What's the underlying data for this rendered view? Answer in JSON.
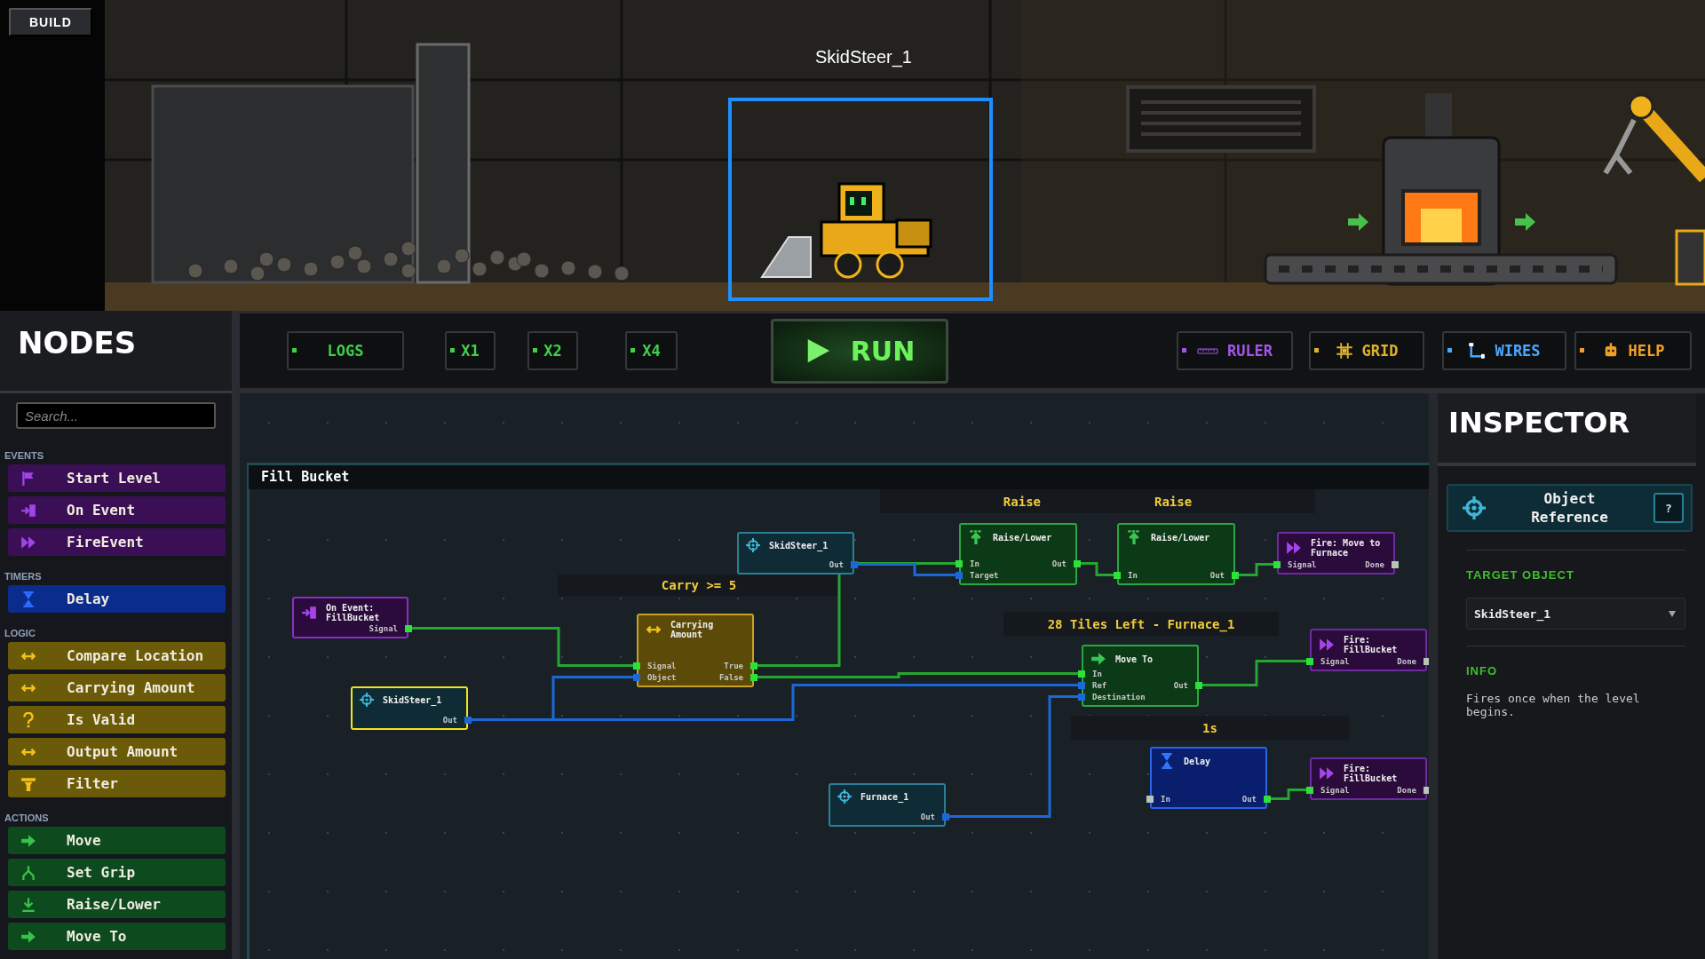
{
  "scene": {
    "mode_badge": "BUILD",
    "object_label": "SkidSteer_1"
  },
  "sidebar": {
    "title": "NODES",
    "search": {
      "placeholder": "Search..."
    },
    "categories": [
      {
        "label": "EVENTS",
        "items": [
          {
            "label": "Start Level",
            "kind": "event"
          },
          {
            "label": "On Event",
            "kind": "event"
          },
          {
            "label": "FireEvent",
            "kind": "event"
          }
        ]
      },
      {
        "label": "TIMERS",
        "items": [
          {
            "label": "Delay",
            "kind": "timer"
          }
        ]
      },
      {
        "label": "LOGIC",
        "items": [
          {
            "label": "Compare Location",
            "kind": "logic"
          },
          {
            "label": "Carrying Amount",
            "kind": "logic"
          },
          {
            "label": "Is Valid",
            "kind": "logic"
          },
          {
            "label": "Output Amount",
            "kind": "logic"
          },
          {
            "label": "Filter",
            "kind": "logic"
          }
        ]
      },
      {
        "label": "ACTIONS",
        "items": [
          {
            "label": "Move",
            "kind": "action"
          },
          {
            "label": "Set Grip",
            "kind": "action"
          },
          {
            "label": "Raise/Lower",
            "kind": "action"
          },
          {
            "label": "Move To",
            "kind": "action"
          }
        ]
      }
    ]
  },
  "toolbar": {
    "buttons": [
      {
        "label": "LOGS",
        "color": "#3fd14a"
      },
      {
        "label": "X1",
        "color": "#3fd14a"
      },
      {
        "label": "X2",
        "color": "#3fd14a"
      },
      {
        "label": "X4",
        "color": "#3fd14a"
      }
    ],
    "run_button": {
      "label": "RUN"
    },
    "tools": [
      {
        "label": "RULER",
        "color": "#a455e8"
      },
      {
        "label": "GRID",
        "color": "#e0b22a"
      },
      {
        "label": "WIRES",
        "color": "#4aa8ff"
      },
      {
        "label": "HELP",
        "color": "#f0a02a"
      }
    ]
  },
  "graph": {
    "group": {
      "title": "Fill Bucket"
    },
    "comment_bars": [
      {
        "labels": [
          "Raise",
          "Raise"
        ]
      },
      {
        "labels": [
          "Carry >= 5"
        ]
      },
      {
        "labels": [
          "28 Tiles Left - Furnace_1"
        ]
      },
      {
        "labels": [
          "1s"
        ]
      }
    ],
    "nodes": [
      {
        "kind": "event",
        "title": "On Event: FillBucket",
        "selected": false,
        "rows": [
          {
            "right": {
              "label": "Signal",
              "kind": "signal"
            }
          }
        ]
      },
      {
        "kind": "object",
        "title": "SkidSteer_1",
        "selected": true,
        "rows": [
          {
            "right": {
              "label": "Out",
              "kind": "object"
            }
          }
        ]
      },
      {
        "kind": "logic",
        "title": "Carrying Amount",
        "selected": false,
        "rows": [
          {
            "left": {
              "label": "Signal",
              "kind": "signal"
            },
            "right": {
              "label": "True",
              "kind": "signal"
            }
          },
          {
            "left": {
              "label": "Object",
              "kind": "object"
            },
            "right": {
              "label": "False",
              "kind": "signal"
            }
          }
        ]
      },
      {
        "kind": "object",
        "title": "SkidSteer_1",
        "selected": false,
        "rows": [
          {
            "right": {
              "label": "Out",
              "kind": "object"
            }
          }
        ]
      },
      {
        "kind": "raise",
        "title": "Raise/Lower",
        "selected": false,
        "rows": [
          {
            "left": {
              "label": "In",
              "kind": "signal"
            },
            "right": {
              "label": "Out",
              "kind": "signal"
            }
          },
          {
            "left": {
              "label": "Target",
              "kind": "object"
            }
          }
        ]
      },
      {
        "kind": "raise",
        "title": "Raise/Lower",
        "selected": false,
        "rows": [
          {
            "left": {
              "label": "In",
              "kind": "signal"
            },
            "right": {
              "label": "Out",
              "kind": "signal"
            }
          }
        ]
      },
      {
        "kind": "fire",
        "title": "Fire: Move to Furnace",
        "selected": false,
        "rows": [
          {
            "left": {
              "label": "Signal",
              "kind": "signal"
            },
            "right": {
              "label": "Done",
              "kind": "idle"
            }
          }
        ]
      },
      {
        "kind": "move",
        "title": "Move To",
        "selected": false,
        "rows": [
          {
            "left": {
              "label": "In",
              "kind": "signal"
            }
          },
          {
            "left": {
              "label": "Ref",
              "kind": "object"
            },
            "right": {
              "label": "Out",
              "kind": "signal"
            }
          },
          {
            "left": {
              "label": "Destination",
              "kind": "object"
            }
          }
        ]
      },
      {
        "kind": "fire",
        "title": "Fire: FillBucket",
        "selected": false,
        "rows": [
          {
            "left": {
              "label": "Signal",
              "kind": "signal"
            },
            "right": {
              "label": "Done",
              "kind": "idle"
            }
          }
        ]
      },
      {
        "kind": "object",
        "title": "Furnace_1",
        "selected": false,
        "rows": [
          {
            "right": {
              "label": "Out",
              "kind": "object"
            }
          }
        ]
      },
      {
        "kind": "timer",
        "title": "Delay",
        "selected": false,
        "rows": [
          {
            "left": {
              "label": "In",
              "kind": "idle"
            },
            "right": {
              "label": "Out",
              "kind": "signal"
            }
          }
        ]
      },
      {
        "kind": "fire",
        "title": "Fire: FillBucket",
        "selected": false,
        "rows": [
          {
            "left": {
              "label": "Signal",
              "kind": "signal"
            },
            "right": {
              "label": "Done",
              "kind": "idle"
            }
          }
        ]
      }
    ]
  },
  "inspector": {
    "title": "INSPECTOR",
    "card": {
      "title": "Object Reference",
      "help": "?"
    },
    "target": {
      "label": "TARGET OBJECT",
      "value": "SkidSteer_1"
    },
    "info": {
      "label": "INFO",
      "text": "Fires once when the level begins."
    }
  }
}
